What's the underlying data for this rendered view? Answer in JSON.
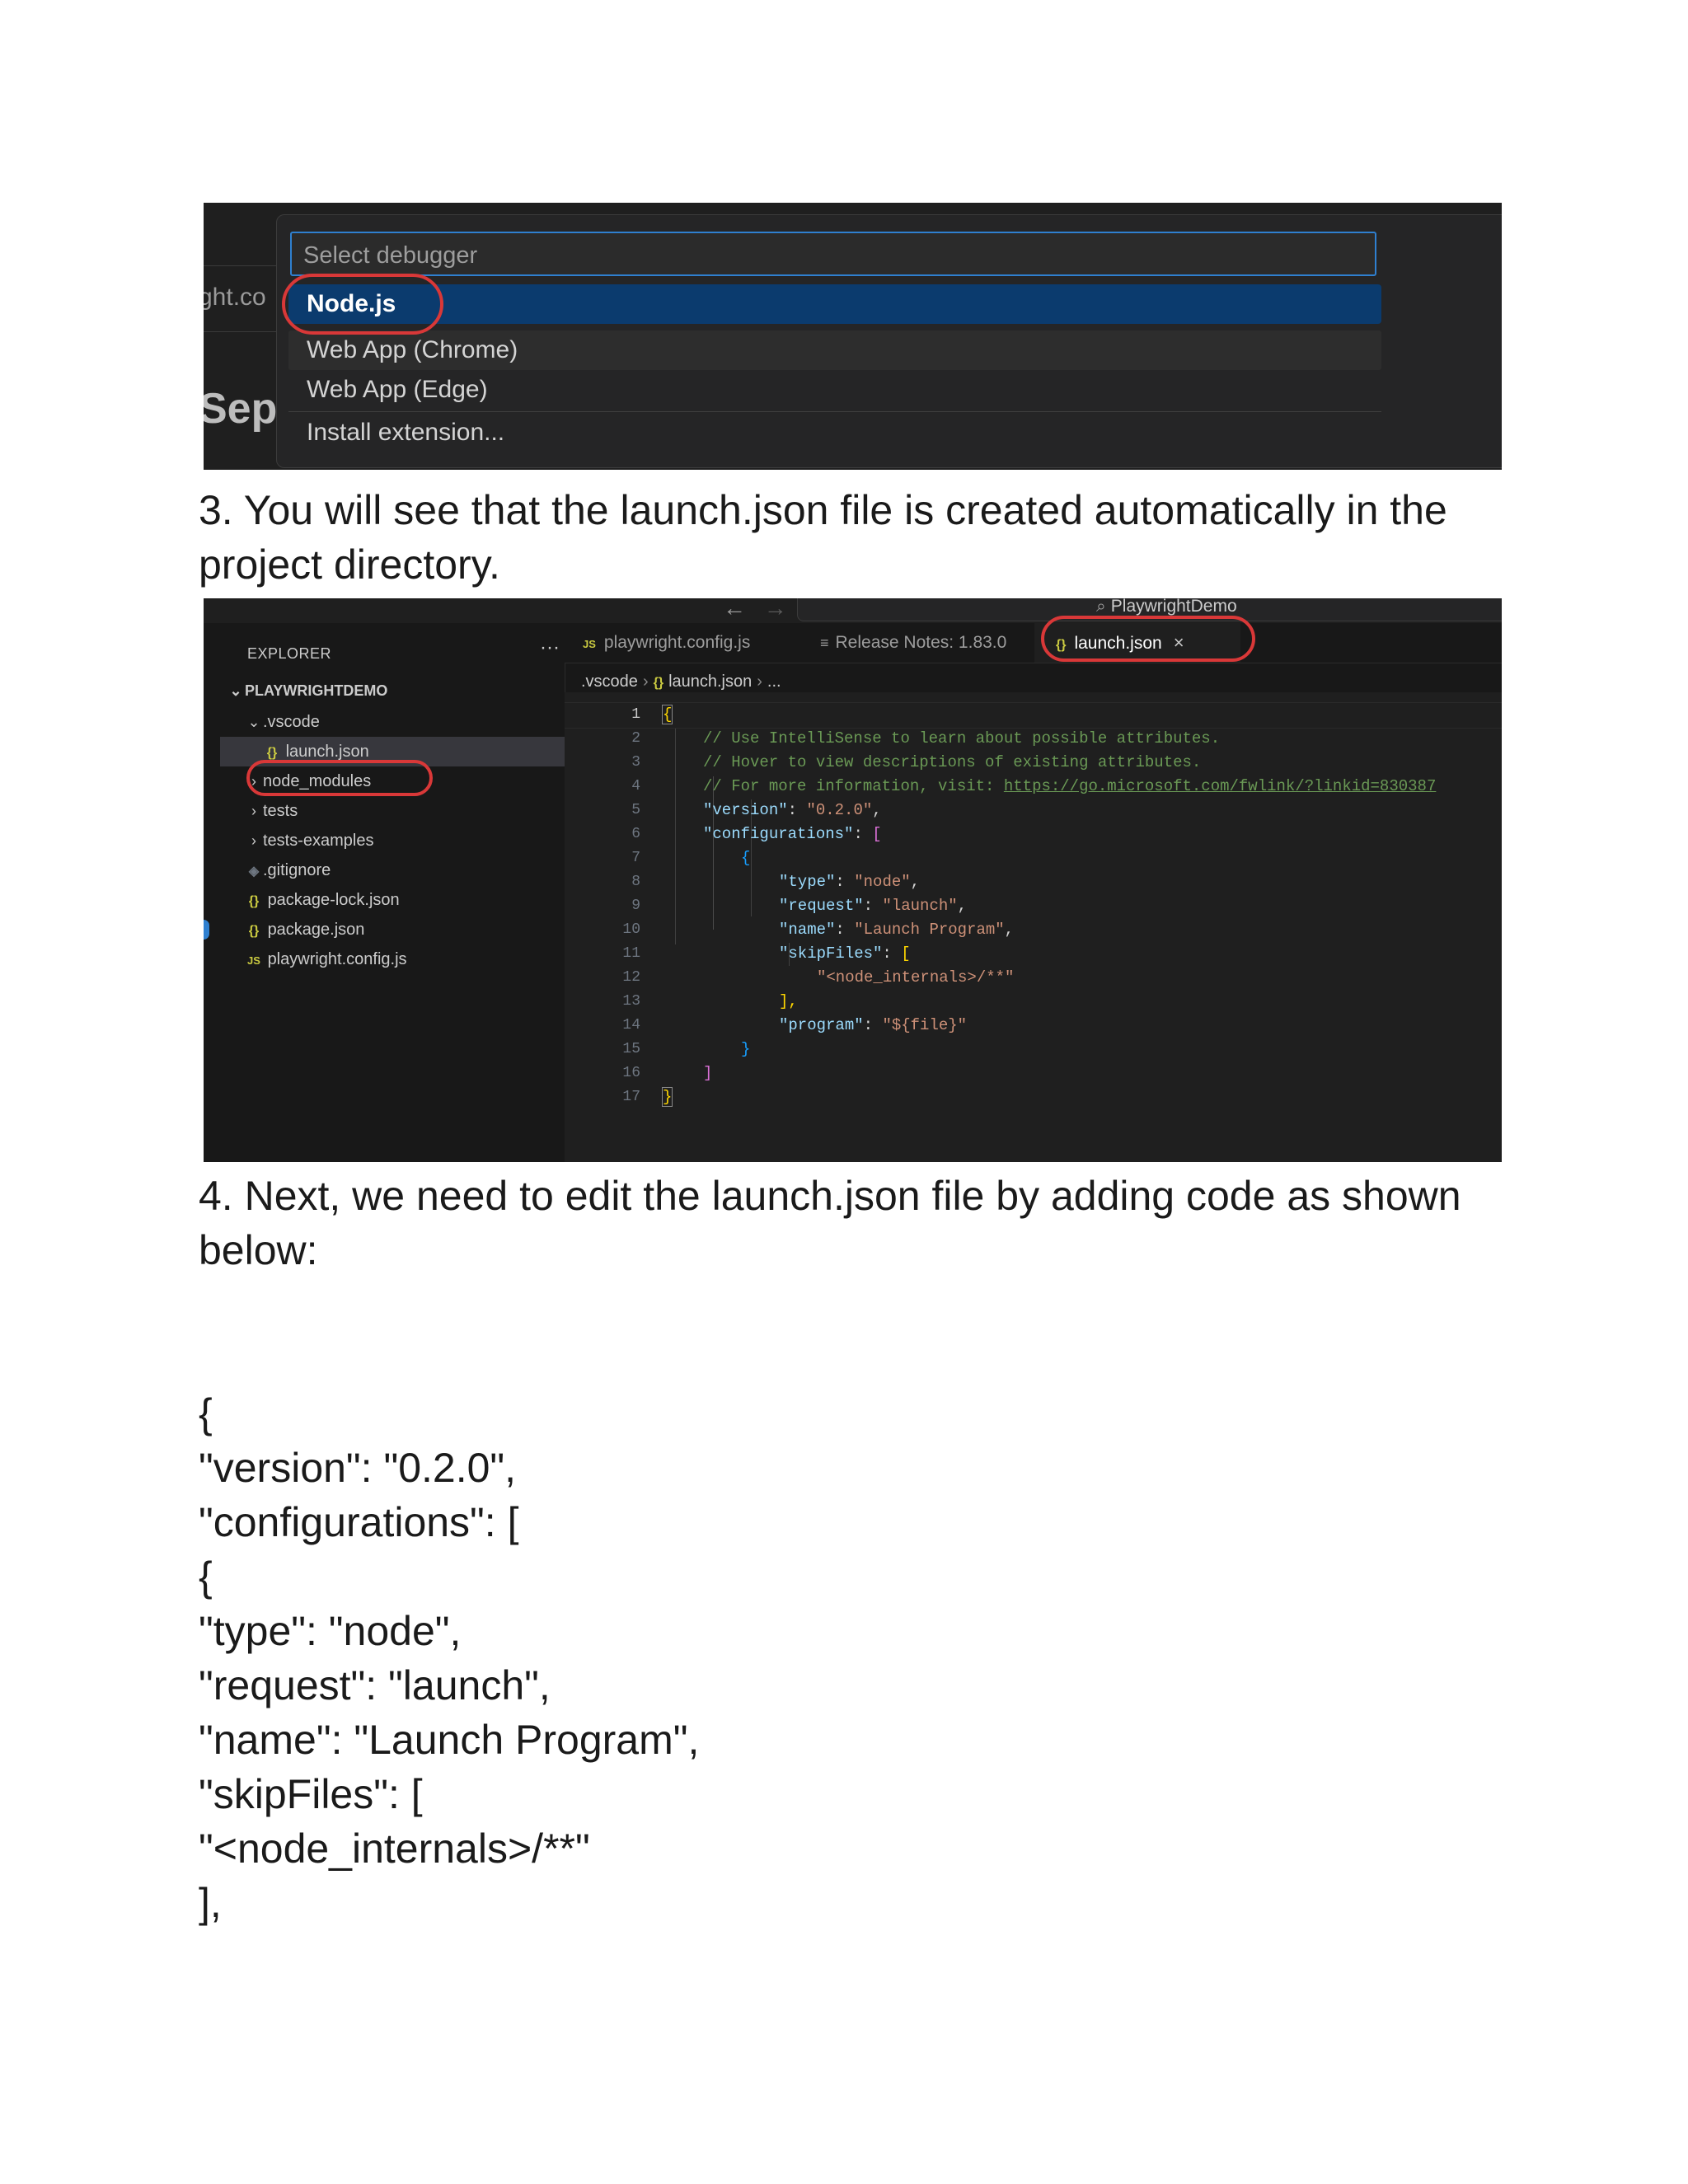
{
  "screenshot1": {
    "background_text_left": "ght.co",
    "background_text_large": "Sep",
    "picker": {
      "placeholder": "Select debugger",
      "items": [
        {
          "label": "Node.js",
          "selected": true
        },
        {
          "label": "Web App (Chrome)",
          "selected": false
        },
        {
          "label": "Web App (Edge)",
          "selected": false
        },
        {
          "label": "Install extension...",
          "selected": false
        }
      ]
    },
    "highlight_color": "#d93838"
  },
  "step3": {
    "line1": "3. You will see that the launch.json file is created automatically in the",
    "line2": "project directory."
  },
  "screenshot2": {
    "titlebar": {
      "nav_back": "←",
      "nav_forward": "→",
      "search_text": "PlaywrightDemo"
    },
    "explorer": {
      "title": "EXPLORER",
      "more": "···",
      "project": "PLAYWRIGHTDEMO",
      "items": [
        {
          "label": ".vscode",
          "icon": "chevron-down"
        },
        {
          "label": "launch.json",
          "icon": "json-icon"
        },
        {
          "label": "node_modules",
          "icon": "chevron-right"
        },
        {
          "label": "tests",
          "icon": "chevron-right"
        },
        {
          "label": "tests-examples",
          "icon": "chevron-right"
        },
        {
          "label": ".gitignore",
          "icon": "git-icon"
        },
        {
          "label": "package-lock.json",
          "icon": "json-icon"
        },
        {
          "label": "package.json",
          "icon": "json-icon"
        },
        {
          "label": "playwright.config.js",
          "icon": "js-icon"
        }
      ]
    },
    "tabs": [
      {
        "label": "playwright.config.js",
        "icon": "JS"
      },
      {
        "label": "Release Notes: 1.83.0",
        "icon": "≡"
      },
      {
        "label": "launch.json",
        "icon": "{}",
        "active": true,
        "close": "×"
      }
    ],
    "breadcrumb": {
      "folder": ".vscode",
      "file": "launch.json",
      "more": "..."
    },
    "line_numbers": [
      "1",
      "2",
      "3",
      "4",
      "5",
      "6",
      "7",
      "8",
      "9",
      "10",
      "11",
      "12",
      "13",
      "14",
      "15",
      "16",
      "17"
    ],
    "code": {
      "l1": "{",
      "l2": "// Use IntelliSense to learn about possible attributes.",
      "l3": "// Hover to view descriptions of existing attributes.",
      "l4_prefix": "// For more information, visit: ",
      "l4_link": "https://go.microsoft.com/fwlink/?linkid=830387",
      "l5_key": "\"version\"",
      "l5_val": "\"0.2.0\"",
      "l6_key": "\"configurations\"",
      "l6_br": "[",
      "l7": "{",
      "l8_key": "\"type\"",
      "l8_val": "\"node\"",
      "l9_key": "\"request\"",
      "l9_val": "\"launch\"",
      "l10_key": "\"name\"",
      "l10_val": "\"Launch Program\"",
      "l11_key": "\"skipFiles\"",
      "l11_br": "[",
      "l12": "\"<node_internals>/**\"",
      "l13": "],",
      "l14_key": "\"program\"",
      "l14_val": "\"${file}\"",
      "l15": "}",
      "l16": "]",
      "l17": "}"
    }
  },
  "step4": {
    "line1": "4. Next, we need to edit the launch.json file by adding code as shown",
    "line2": "below:"
  },
  "code_listing": [
    "{",
    "\"version\": \"0.2.0\",",
    "\"configurations\": [",
    "{",
    "\"type\": \"node\",",
    "\"request\": \"launch\",",
    "\"name\": \"Launch Program\",",
    "\"skipFiles\": [",
    "\"<node_internals>/**\"",
    "],"
  ]
}
